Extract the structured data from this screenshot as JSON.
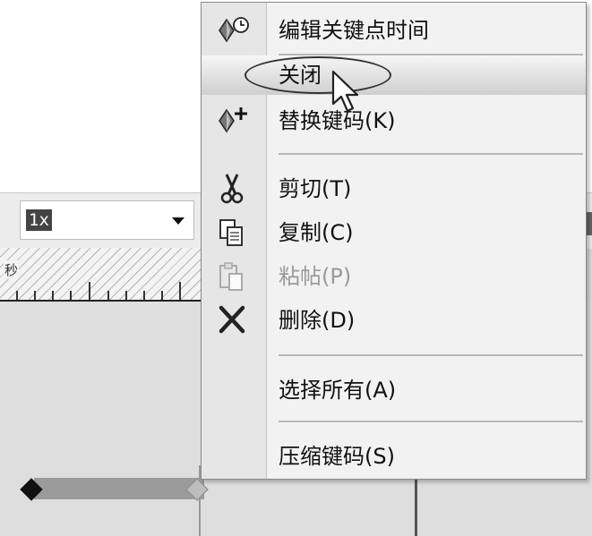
{
  "toolbar": {
    "playback_speed_value": "1x"
  },
  "ruler": {
    "unit_label": "秒"
  },
  "context_menu": {
    "items": [
      {
        "label": "编辑关键点时间",
        "icon": "keyframe-clock-icon",
        "enabled": true
      },
      {
        "label": "关闭",
        "icon": "",
        "enabled": true,
        "highlighted": true
      },
      {
        "label": "替换键码(K)",
        "icon": "keyframe-add-icon",
        "enabled": true
      },
      {
        "label": "剪切(T)",
        "icon": "scissors-icon",
        "enabled": true
      },
      {
        "label": "复制(C)",
        "icon": "copy-icon",
        "enabled": true
      },
      {
        "label": "粘帖(P)",
        "icon": "paste-icon",
        "enabled": false
      },
      {
        "label": "删除(D)",
        "icon": "delete-x-icon",
        "enabled": true
      },
      {
        "label": "选择所有(A)",
        "icon": "",
        "enabled": true
      },
      {
        "label": "压缩键码(S)",
        "icon": "",
        "enabled": true
      }
    ]
  },
  "colors": {
    "menu_background": "#f2f2f2",
    "icon_column": "#e6e6e6",
    "highlight_top": "#f6f6f6",
    "highlight_bottom": "#cfcfcf",
    "disabled_text": "#9a9a9a",
    "keyframe_bar": "#9b9b9b"
  }
}
